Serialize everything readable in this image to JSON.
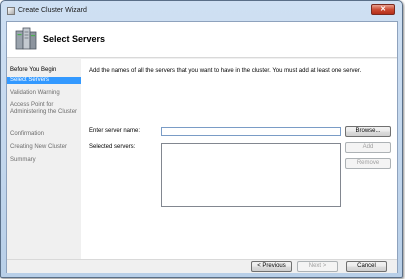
{
  "window": {
    "title": "Create Cluster Wizard",
    "close_glyph": "✕"
  },
  "header": {
    "title": "Select Servers",
    "icon": "server-cluster-icon"
  },
  "nav": {
    "items": [
      {
        "label": "Before You Begin",
        "state": "done"
      },
      {
        "label": "Select Servers",
        "state": "active"
      },
      {
        "label": "Validation Warning",
        "state": "pending"
      },
      {
        "label": "Access Point for Administering the Cluster",
        "state": "pending"
      },
      {
        "label": "Confirmation",
        "state": "pending"
      },
      {
        "label": "Creating New Cluster",
        "state": "pending"
      },
      {
        "label": "Summary",
        "state": "pending"
      }
    ]
  },
  "main": {
    "instructions": "Add the names of all the servers that you want to have in the cluster. You must add at least one server.",
    "server_name_label": "Enter server name:",
    "server_name_value": "",
    "selected_label": "Selected servers:",
    "selected_servers": [],
    "browse_label": "Browse...",
    "add_label": "Add",
    "remove_label": "Remove"
  },
  "footer": {
    "previous_label": "< Previous",
    "next_label": "Next >",
    "cancel_label": "Cancel"
  },
  "colors": {
    "selection": "#3399ff",
    "titlebar": "#cfe0f3",
    "close": "#cc4b33"
  }
}
